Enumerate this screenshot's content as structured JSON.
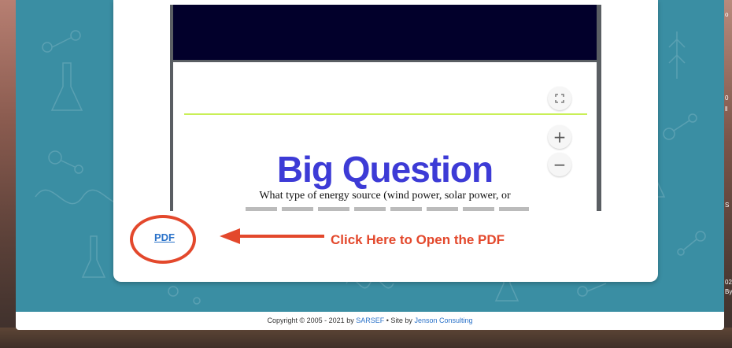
{
  "viewer": {
    "page_title": "Big Question",
    "page_body": "What type of energy source (wind power, solar power, or",
    "controls": {
      "fullscreen_icon": "fullscreen-icon",
      "zoom_in_label": "+",
      "zoom_out_label": "−"
    }
  },
  "pdf_link": {
    "label": "PDF"
  },
  "annotation": {
    "text": "Click Here to Open the PDF",
    "color": "#e3482c"
  },
  "footer": {
    "copyright": "Copyright © 2005 - 2021 by",
    "org": "SARSEF",
    "separator": "• Site by",
    "site_by": "Jenson Consulting"
  },
  "side_fragments": [
    "o",
    "0",
    "ll",
    "S",
    "02",
    "By"
  ],
  "colors": {
    "teal": "#3a8ea3",
    "title_blue": "#3d3bd6",
    "viewer_top": "#02002b",
    "lime": "#c9ef56",
    "link": "#2a72c9"
  }
}
